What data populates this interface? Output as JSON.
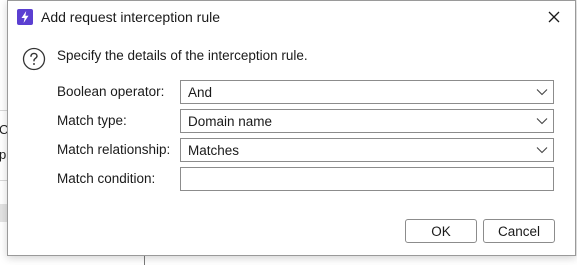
{
  "background": {
    "left_fragments": [
      "Co",
      "p"
    ]
  },
  "dialog": {
    "title": "Add request interception rule",
    "intro": "Specify the details of the interception rule.",
    "fields": {
      "boolean_operator": {
        "label": "Boolean operator:",
        "value": "And"
      },
      "match_type": {
        "label": "Match type:",
        "value": "Domain name"
      },
      "match_relationship": {
        "label": "Match relationship:",
        "value": "Matches"
      },
      "match_condition": {
        "label": "Match condition:",
        "value": ""
      }
    },
    "buttons": {
      "ok": "OK",
      "cancel": "Cancel"
    }
  },
  "icons": {
    "app": "lightning-bolt-icon",
    "close": "close-icon",
    "help": "question-circle-icon",
    "dropdown": "chevron-down-icon"
  },
  "colors": {
    "app_icon_bg": "#5b3fd1"
  }
}
